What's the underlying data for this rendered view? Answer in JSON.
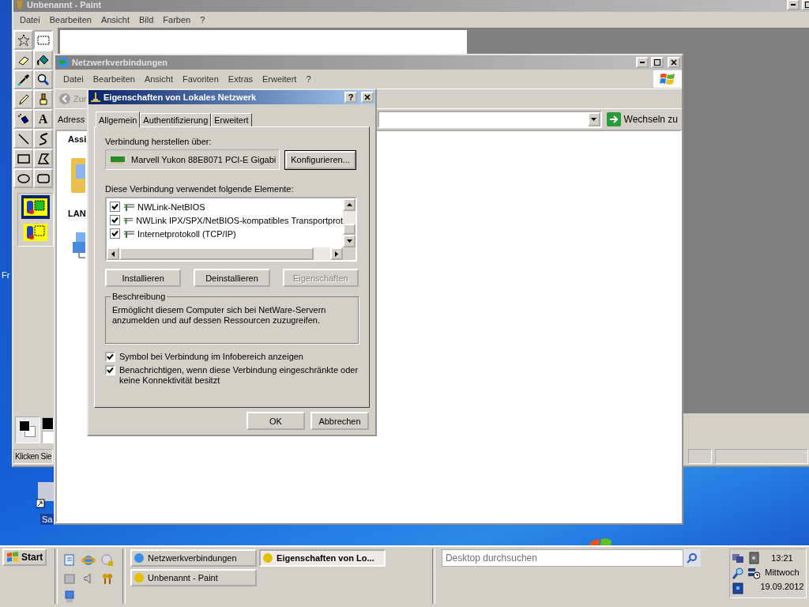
{
  "paint": {
    "title": "Unbenannt - Paint",
    "menu": [
      "Datei",
      "Bearbeiten",
      "Ansicht",
      "Bild",
      "Farben",
      "?"
    ],
    "tools": [
      {
        "selected": false
      },
      {
        "selected": true
      },
      {
        "selected": false
      },
      {
        "selected": false
      },
      {
        "selected": false
      },
      {
        "selected": false
      },
      {
        "selected": false
      },
      {
        "selected": false
      },
      {
        "selected": false
      },
      {
        "selected": false,
        "label": "A"
      },
      {
        "selected": false
      },
      {
        "selected": false
      },
      {
        "selected": false
      },
      {
        "selected": false
      },
      {
        "selected": false
      },
      {
        "selected": false
      }
    ],
    "tool_options": [
      {
        "selected": true
      },
      {
        "selected": false
      }
    ],
    "status": "Klicken Sie"
  },
  "desktop_labels": [
    "Fr",
    "Sa"
  ],
  "explorer": {
    "title": "Netzwerkverbindungen",
    "menu": [
      "Datei",
      "Bearbeiten",
      "Ansicht",
      "Favoriten",
      "Extras",
      "Erweitert",
      "?"
    ],
    "back_button": "Zur",
    "address_label": "Adress",
    "go_button": "Wechseln zu",
    "panel_headings": [
      "Assi",
      "LAN"
    ]
  },
  "dialog": {
    "title": "Eigenschaften von Lokales Netzwerk",
    "help_button": "?",
    "tabs": [
      {
        "label": "Allgemein",
        "selected": true
      },
      {
        "label": "Authentifizierung",
        "selected": false
      },
      {
        "label": "Erweitert",
        "selected": false
      }
    ],
    "connect_label": "Verbindung herstellen über:",
    "adapter": "Marvell Yukon 88E8071 PCI-E Gigabi",
    "configure_button": "Konfigurieren...",
    "components_label": "Diese Verbindung verwendet folgende Elemente:",
    "components": [
      {
        "label": "NWLink-NetBIOS",
        "checked": true
      },
      {
        "label": "NWLink IPX/SPX/NetBIOS-kompatibles Transportprot",
        "checked": true
      },
      {
        "label": "Internetprotokoll (TCP/IP)",
        "checked": true
      }
    ],
    "buttons": [
      {
        "label": "Installieren",
        "disabled": false
      },
      {
        "label": "Deinstallieren",
        "disabled": false
      },
      {
        "label": "Eigenschaften",
        "disabled": true
      }
    ],
    "description_title": "Beschreibung",
    "description": "Ermöglicht diesem Computer sich bei NetWare-Servern anzumelden und auf dessen Ressourcen zuzugreifen.",
    "options": [
      {
        "label": "Symbol bei Verbindung im Infobereich anzeigen",
        "checked": true
      },
      {
        "label": "Benachrichtigen, wenn diese Verbindung eingeschränkte oder keine Konnektivität besitzt",
        "checked": true
      }
    ],
    "footer_buttons": [
      "OK",
      "Abbrechen"
    ]
  },
  "taskbar": {
    "start": "Start",
    "tasks": [
      {
        "label": "Netzwerkverbindungen",
        "selected": false
      },
      {
        "label": "Eigenschaften von Lo...",
        "selected": true
      },
      {
        "label": "Unbenannt - Paint",
        "selected": false
      }
    ],
    "search": {
      "placeholder": "Desktop durchsuchen"
    },
    "clock": {
      "time": "13:21",
      "day": "Mittwoch",
      "date": "19.09.2012"
    }
  }
}
